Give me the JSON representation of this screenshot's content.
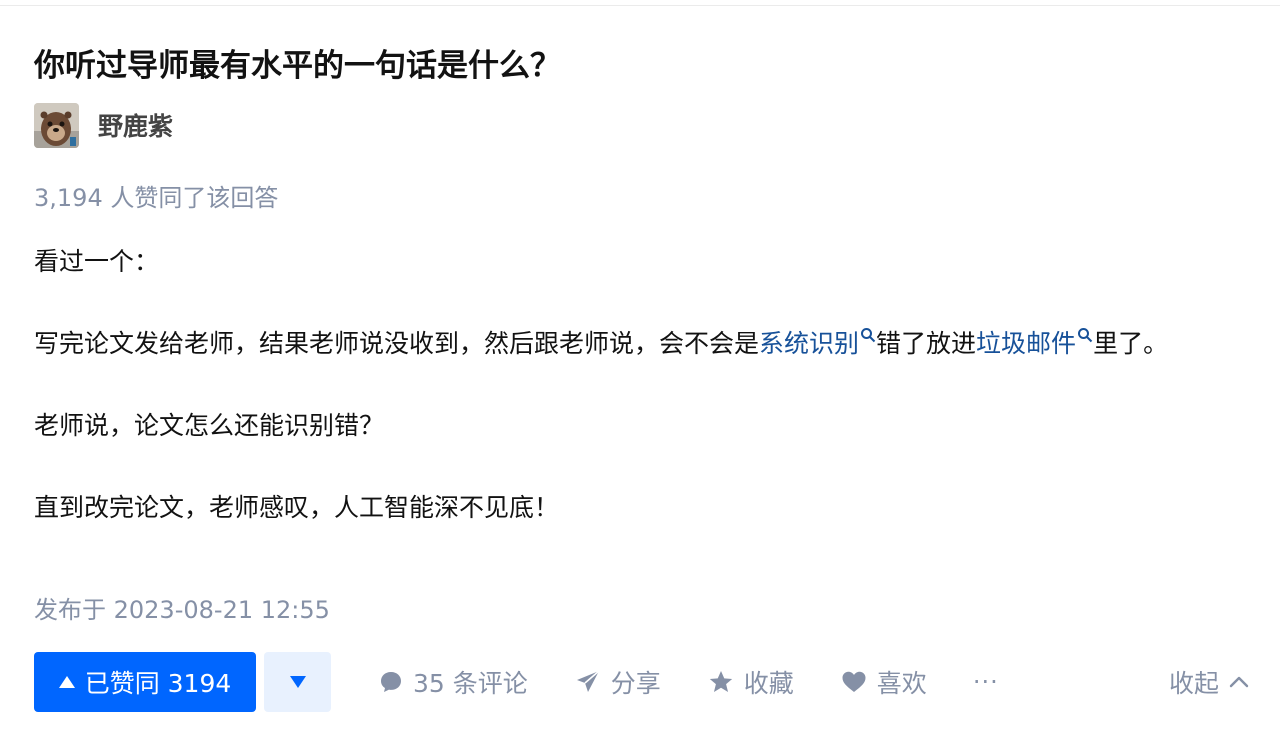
{
  "question": {
    "title": "你听过导师最有水平的一句话是什么？"
  },
  "author": {
    "name": "野鹿紫",
    "avatar_icon": "otter-avatar"
  },
  "answer": {
    "votes_summary": "3,194 人赞同了该回答",
    "p1": "看过一个：",
    "p2_part1": "写完论文发给老师，结果老师说没收到，然后跟老师说，会不会是",
    "p2_link1": "系统识别",
    "p2_part2": "错了放进",
    "p2_link2": "垃圾邮件",
    "p2_part3": "里了。",
    "p3": "老师说，论文怎么还能识别错？",
    "p4": "直到改完论文，老师感叹，人工智能深不见底！",
    "published": "发布于 2023-08-21 12:55"
  },
  "actions": {
    "upvote_label": "已赞同 3194",
    "comments_label": "35 条评论",
    "share_label": "分享",
    "favorite_label": "收藏",
    "like_label": "喜欢",
    "more_label": "···",
    "collapse_label": "收起"
  },
  "colors": {
    "accent": "#0066ff",
    "link": "#175199",
    "meta": "#8590a6",
    "downvote_bg": "#e8f1fe"
  }
}
